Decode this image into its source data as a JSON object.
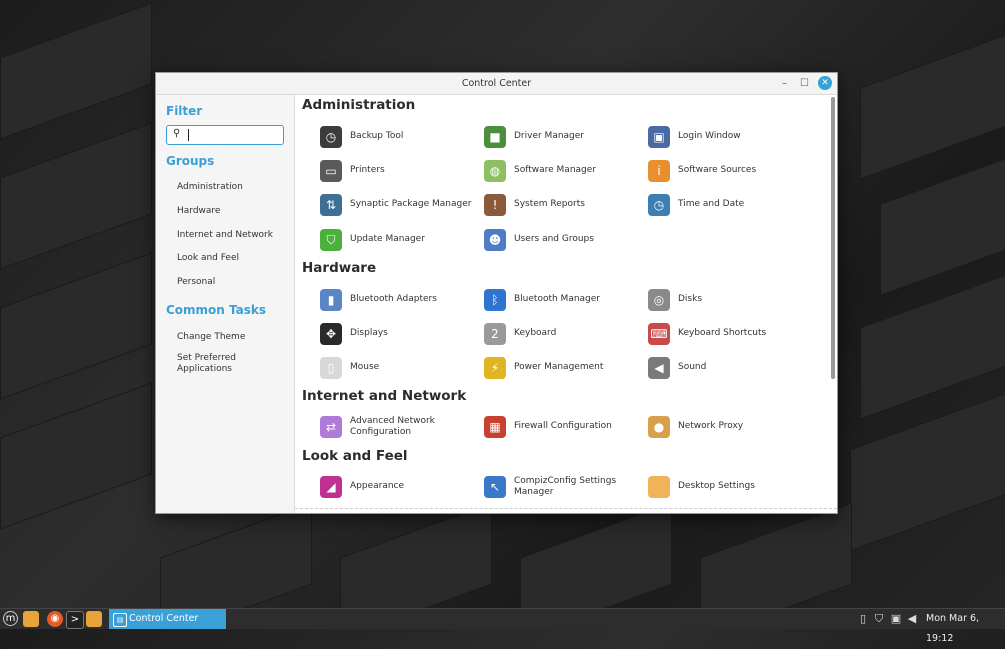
{
  "window": {
    "title": "Control Center",
    "min_glyph": "–",
    "max_glyph": "☐",
    "close_glyph": "✕"
  },
  "sidebar": {
    "filter_heading": "Filter",
    "search_value": "",
    "groups_heading": "Groups",
    "groups": [
      "Administration",
      "Hardware",
      "Internet and Network",
      "Look and Feel",
      "Personal"
    ],
    "tasks_heading": "Common Tasks",
    "tasks": [
      "Change Theme",
      "Set Preferred Applications"
    ]
  },
  "sections": {
    "administration": {
      "title": "Administration",
      "items": [
        {
          "label": "Backup Tool",
          "icon": "backup-icon",
          "color": "#3c3c3c",
          "glyph": "◷"
        },
        {
          "label": "Driver Manager",
          "icon": "driver-icon",
          "color": "#4b8f3e",
          "glyph": "■"
        },
        {
          "label": "Login Window",
          "icon": "login-icon",
          "color": "#4a6aa3",
          "glyph": "▣"
        },
        {
          "label": "Printers",
          "icon": "printer-icon",
          "color": "#5a5a5a",
          "glyph": "▭"
        },
        {
          "label": "Software Manager",
          "icon": "software-manager-icon",
          "color": "#8cc063",
          "glyph": "◍"
        },
        {
          "label": "Software Sources",
          "icon": "software-sources-icon",
          "color": "#e8902f",
          "glyph": "i"
        },
        {
          "label": "Synaptic Package Manager",
          "icon": "synaptic-icon",
          "color": "#3f6f93",
          "glyph": "⇅"
        },
        {
          "label": "System Reports",
          "icon": "reports-icon",
          "color": "#8a5a3a",
          "glyph": "!"
        },
        {
          "label": "Time and Date",
          "icon": "clock-icon",
          "color": "#3b7fb5",
          "glyph": "◷"
        },
        {
          "label": "Update Manager",
          "icon": "shield-icon",
          "color": "#4caf3e",
          "glyph": "⛉"
        },
        {
          "label": "Users and Groups",
          "icon": "users-icon",
          "color": "#4f7cc4",
          "glyph": "☻"
        }
      ]
    },
    "hardware": {
      "title": "Hardware",
      "items": [
        {
          "label": "Bluetooth Adapters",
          "icon": "bluetooth-adapter-icon",
          "color": "#5a86c8",
          "glyph": "▮"
        },
        {
          "label": "Bluetooth Manager",
          "icon": "bluetooth-icon",
          "color": "#2f74d0",
          "glyph": "ᛒ"
        },
        {
          "label": "Disks",
          "icon": "disk-icon",
          "color": "#8a8a8a",
          "glyph": "◎"
        },
        {
          "label": "Displays",
          "icon": "display-icon",
          "color": "#2a2a2a",
          "glyph": "✥"
        },
        {
          "label": "Keyboard",
          "icon": "keyboard-icon",
          "color": "#9a9a9a",
          "glyph": "2"
        },
        {
          "label": "Keyboard Shortcuts",
          "icon": "shortcuts-icon",
          "color": "#c84a4a",
          "glyph": "⌨"
        },
        {
          "label": "Mouse",
          "icon": "mouse-icon",
          "color": "#d8d8d8",
          "glyph": "▯"
        },
        {
          "label": "Power Management",
          "icon": "power-icon",
          "color": "#e0b521",
          "glyph": "⚡"
        },
        {
          "label": "Sound",
          "icon": "speaker-icon",
          "color": "#7a7a7a",
          "glyph": "◀"
        }
      ]
    },
    "internet": {
      "title": "Internet and Network",
      "items": [
        {
          "label": "Advanced Network Configuration",
          "icon": "network-icon",
          "color": "#b07ad8",
          "glyph": "⇄"
        },
        {
          "label": "Firewall Configuration",
          "icon": "firewall-icon",
          "color": "#c8402e",
          "glyph": "▦"
        },
        {
          "label": "Network Proxy",
          "icon": "proxy-icon",
          "color": "#d8a04a",
          "glyph": "●"
        }
      ]
    },
    "look": {
      "title": "Look and Feel",
      "items": [
        {
          "label": "Appearance",
          "icon": "appearance-icon",
          "color": "#c03090",
          "glyph": "◢"
        },
        {
          "label": "CompizConfig Settings Manager",
          "icon": "compiz-icon",
          "color": "#3a78c8",
          "glyph": "↖"
        },
        {
          "label": "Desktop Settings",
          "icon": "desktop-icon",
          "color": "#f0b35a",
          "glyph": ""
        }
      ]
    }
  },
  "taskbar": {
    "task_label": "Control Center",
    "clock": "Mon Mar  6, 19:12"
  }
}
